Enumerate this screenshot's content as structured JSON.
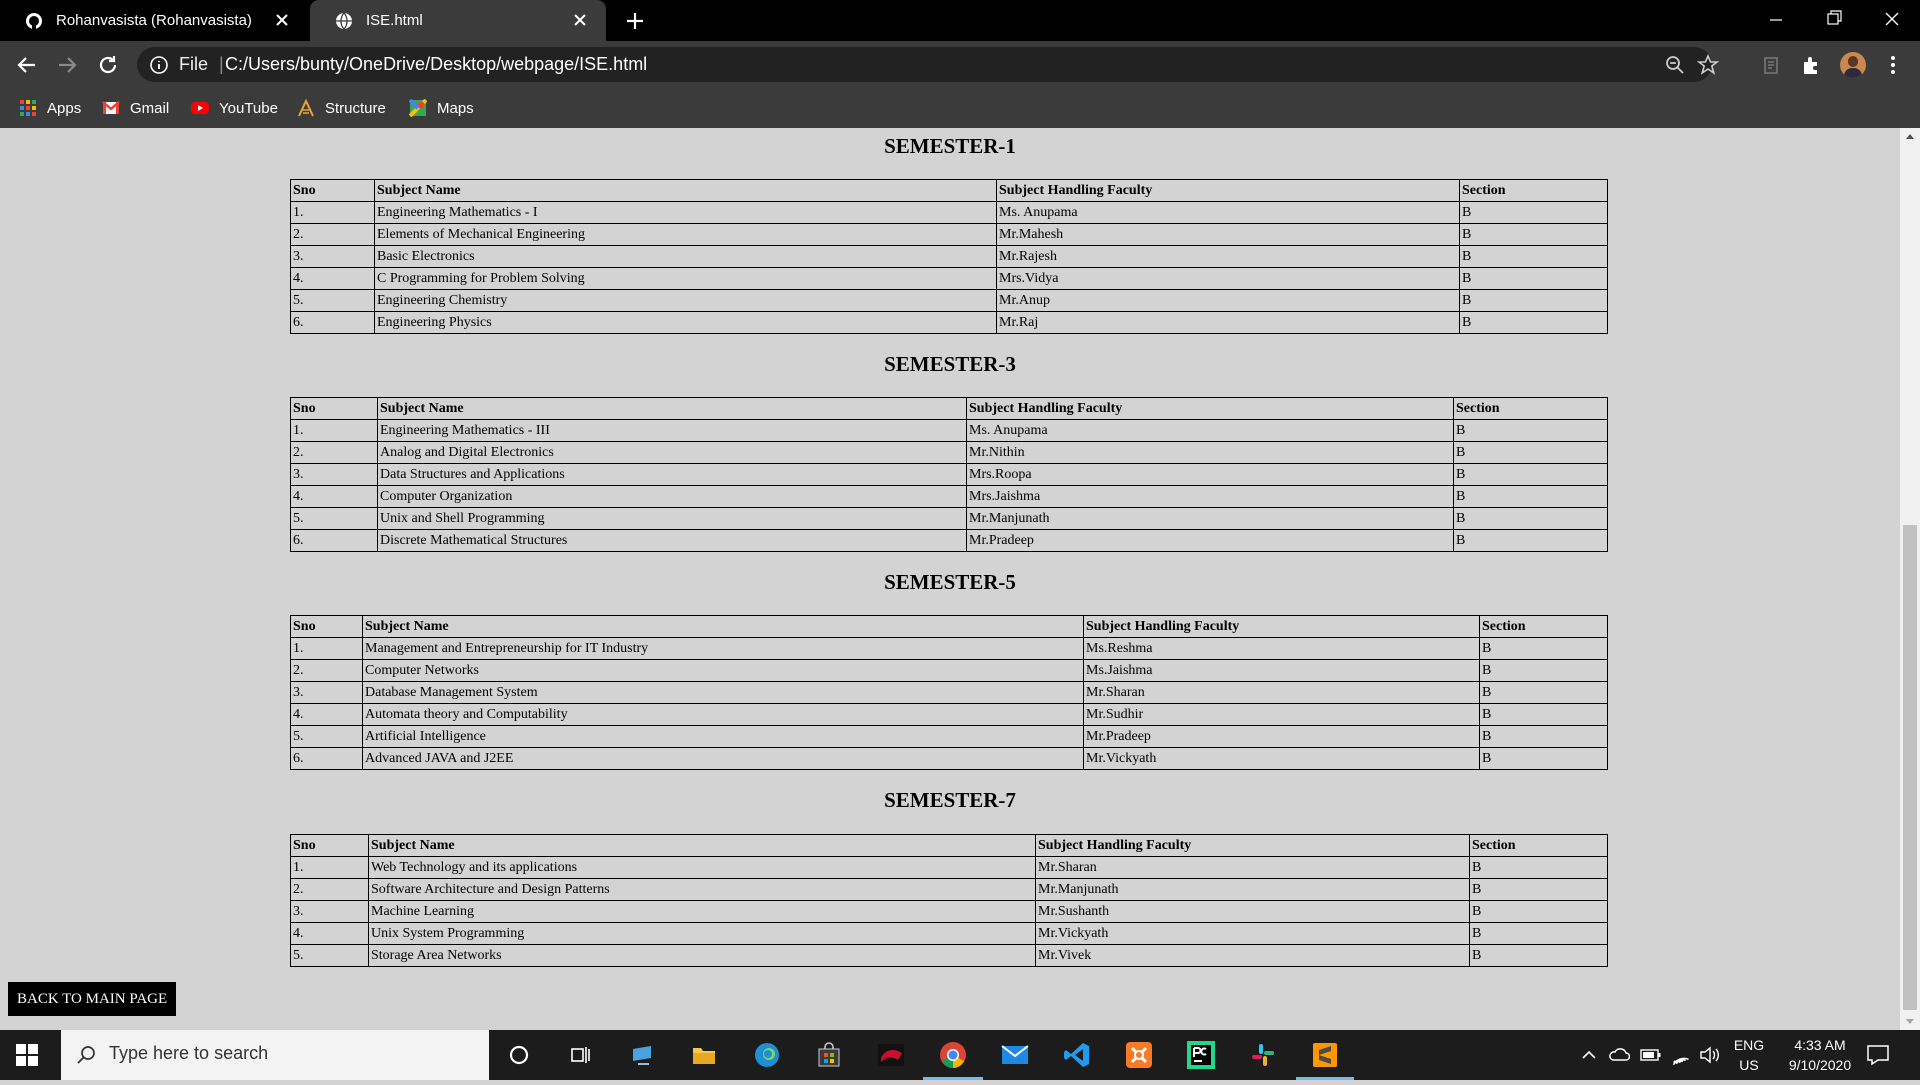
{
  "browser": {
    "tabs": [
      {
        "title": "Rohanvasista (Rohanvasista)",
        "icon": "github-icon",
        "active": false
      },
      {
        "title": "ISE.html",
        "icon": "globe-icon",
        "active": true
      }
    ],
    "omnibox": {
      "scheme_label": "File",
      "separator": "|",
      "url": "C:/Users/bunty/OneDrive/Desktop/webpage/ISE.html"
    },
    "bookmarks": [
      {
        "label": "Apps",
        "icon": "apps-grid-icon"
      },
      {
        "label": "Gmail",
        "icon": "gmail-icon"
      },
      {
        "label": "YouTube",
        "icon": "youtube-icon"
      },
      {
        "label": "Structure",
        "icon": "structure-icon"
      },
      {
        "label": "Maps",
        "icon": "maps-icon"
      }
    ]
  },
  "page": {
    "table_headers": {
      "sno": "Sno",
      "subject": "Subject Name",
      "faculty": "Subject Handling Faculty",
      "section": "Section"
    },
    "semesters": [
      {
        "title": "SEMESTER-1",
        "rows": [
          {
            "sno": "1.",
            "subject": "Engineering Mathematics - I",
            "faculty": "Ms. Anupama",
            "section": "B"
          },
          {
            "sno": "2.",
            "subject": "Elements of Mechanical Engineering",
            "faculty": "Mr.Mahesh",
            "section": "B"
          },
          {
            "sno": "3.",
            "subject": "Basic Electronics",
            "faculty": "Mr.Rajesh",
            "section": "B"
          },
          {
            "sno": "4.",
            "subject": "C Programming for Problem Solving",
            "faculty": "Mrs.Vidya",
            "section": "B"
          },
          {
            "sno": "5.",
            "subject": "Engineering Chemistry",
            "faculty": "Mr.Anup",
            "section": "B"
          },
          {
            "sno": "6.",
            "subject": "Engineering Physics",
            "faculty": "Mr.Raj",
            "section": "B"
          }
        ]
      },
      {
        "title": "SEMESTER-3",
        "rows": [
          {
            "sno": "1.",
            "subject": "Engineering Mathematics - III",
            "faculty": "Ms. Anupama",
            "section": "B"
          },
          {
            "sno": "2.",
            "subject": "Analog and Digital Electronics",
            "faculty": "Mr.Nithin",
            "section": "B"
          },
          {
            "sno": "3.",
            "subject": "Data Structures and Applications",
            "faculty": "Mrs.Roopa",
            "section": "B"
          },
          {
            "sno": "4.",
            "subject": "Computer Organization",
            "faculty": "Mrs.Jaishma",
            "section": "B"
          },
          {
            "sno": "5.",
            "subject": "Unix and Shell Programming",
            "faculty": "Mr.Manjunath",
            "section": "B"
          },
          {
            "sno": "6.",
            "subject": "Discrete Mathematical Structures",
            "faculty": "Mr.Pradeep",
            "section": "B"
          }
        ]
      },
      {
        "title": "SEMESTER-5",
        "rows": [
          {
            "sno": "1.",
            "subject": "Management and Entrepreneurship for IT Industry",
            "faculty": "Ms.Reshma",
            "section": "B"
          },
          {
            "sno": "2.",
            "subject": "Computer Networks",
            "faculty": "Ms.Jaishma",
            "section": "B"
          },
          {
            "sno": "3.",
            "subject": "Database Management System",
            "faculty": "Mr.Sharan",
            "section": "B"
          },
          {
            "sno": "4.",
            "subject": "Automata theory and Computability",
            "faculty": "Mr.Sudhir",
            "section": "B"
          },
          {
            "sno": "5.",
            "subject": "Artificial Intelligence",
            "faculty": "Mr.Pradeep",
            "section": "B"
          },
          {
            "sno": "6.",
            "subject": "Advanced JAVA and J2EE",
            "faculty": "Mr.Vickyath",
            "section": "B"
          }
        ]
      },
      {
        "title": "SEMESTER-7",
        "rows": [
          {
            "sno": "1.",
            "subject": "Web Technology and its applications",
            "faculty": "Mr.Sharan",
            "section": "B"
          },
          {
            "sno": "2.",
            "subject": "Software Architecture and Design Patterns",
            "faculty": "Mr.Manjunath",
            "section": "B"
          },
          {
            "sno": "3.",
            "subject": "Machine Learning",
            "faculty": "Mr.Sushanth",
            "section": "B"
          },
          {
            "sno": "4.",
            "subject": "Unix System Programming",
            "faculty": "Mr.Vickyath",
            "section": "B"
          },
          {
            "sno": "5.",
            "subject": "Storage Area Networks",
            "faculty": "Mr.Vivek",
            "section": "B"
          }
        ]
      }
    ],
    "back_button": "BACK TO MAIN PAGE"
  },
  "taskbar": {
    "search_placeholder": "Type here to search",
    "language": "ENG",
    "region": "US",
    "time": "4:33 AM",
    "date": "9/10/2020",
    "pinned_apps": [
      "cortana-icon",
      "task-view-icon",
      "pc-icon",
      "file-explorer-icon",
      "edge-icon",
      "store-icon",
      "game-icon",
      "chrome-icon",
      "mail-icon",
      "vscode-icon",
      "xampp-icon",
      "pycharm-icon",
      "slack-icon",
      "sublime-icon"
    ]
  },
  "colors": {
    "page_background": "#d3d3d3",
    "chrome_dark": "#3b3b3b",
    "taskbar": "#1c1c1c",
    "active_app_underline": "#76b9ed"
  }
}
